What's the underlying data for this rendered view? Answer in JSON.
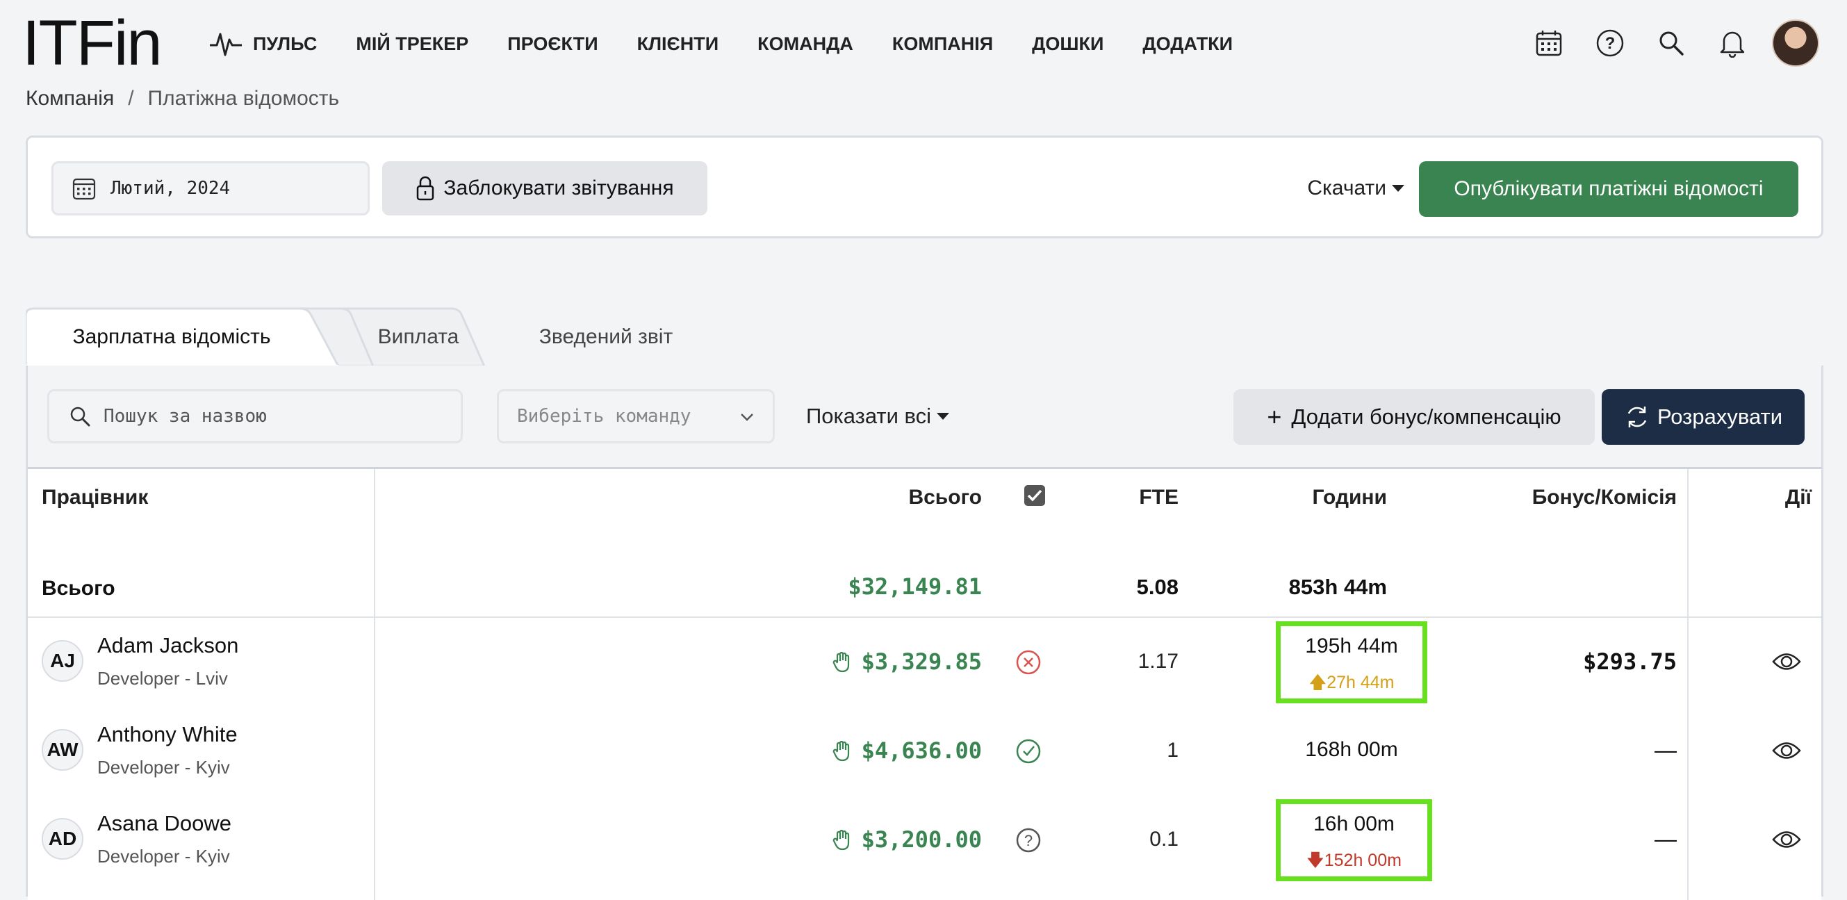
{
  "app": {
    "logo": "ITFin",
    "nav": [
      {
        "label": "ПУЛЬС",
        "icon": "pulse-icon"
      },
      {
        "label": "МІЙ ТРЕКЕР"
      },
      {
        "label": "ПРОЄКТИ"
      },
      {
        "label": "КЛІЄНТИ"
      },
      {
        "label": "КОМАНДА"
      },
      {
        "label": "КОМПАНІЯ"
      },
      {
        "label": "ДОШКИ"
      },
      {
        "label": "ДОДАТКИ"
      }
    ],
    "top_icons": [
      "calendar-icon",
      "help-icon",
      "search-icon",
      "bell-icon",
      "user-avatar"
    ]
  },
  "breadcrumb": {
    "parent": "Компанія",
    "separator": "/",
    "current": "Платіжна відомость"
  },
  "controls": {
    "period": "Лютий, 2024",
    "lock_label": "Заблокувати звітування",
    "download_label": "Скачати",
    "publish_label": "Опублікувати платіжні відомості"
  },
  "tabs": [
    {
      "label": "Зарплатна відомість",
      "active": true
    },
    {
      "label": "Виплата",
      "active": false
    },
    {
      "label": "Зведений звіт",
      "active": false
    }
  ],
  "toolbar": {
    "search_placeholder": "Пошук за назвою",
    "team_placeholder": "Виберіть команду",
    "show_all_label": "Показати всі",
    "add_bonus_label": "Додати бонус/компенсацію",
    "calculate_label": "Розрахувати"
  },
  "table": {
    "headers": {
      "employee": "Працівник",
      "total": "Всього",
      "fte": "FTE",
      "hours": "Години",
      "bonus": "Бонус/Комісія",
      "actions": "Дії"
    },
    "totals": {
      "label": "Всього",
      "amount": "$32,149.81",
      "fte": "5.08",
      "hours": "853h 44m"
    },
    "rows": [
      {
        "initials": "AJ",
        "name": "Adam Jackson",
        "role": "Developer - Lviv",
        "amount": "$3,329.85",
        "status": "rejected",
        "fte": "1.17",
        "hours": "195h 44m",
        "hours_delta": "27h 44m",
        "delta_dir": "up",
        "bonus": "$293.75",
        "highlighted": true
      },
      {
        "initials": "AW",
        "name": "Anthony White",
        "role": "Developer - Kyiv",
        "amount": "$4,636.00",
        "status": "approved",
        "fte": "1",
        "hours": "168h 00m",
        "hours_delta": "",
        "delta_dir": "",
        "bonus": "—",
        "highlighted": false
      },
      {
        "initials": "AD",
        "name": "Asana Doowe",
        "role": "Developer - Kyiv",
        "amount": "$3,200.00",
        "status": "unknown",
        "fte": "0.1",
        "hours": "16h 00m",
        "hours_delta": "152h 00m",
        "delta_dir": "down",
        "bonus": "—",
        "highlighted": true
      }
    ]
  },
  "colors": {
    "accent_green": "#3a8451",
    "dark_button": "#1c2d45",
    "highlight": "#66e01f",
    "up": "#d4a017",
    "down": "#c0392b"
  }
}
